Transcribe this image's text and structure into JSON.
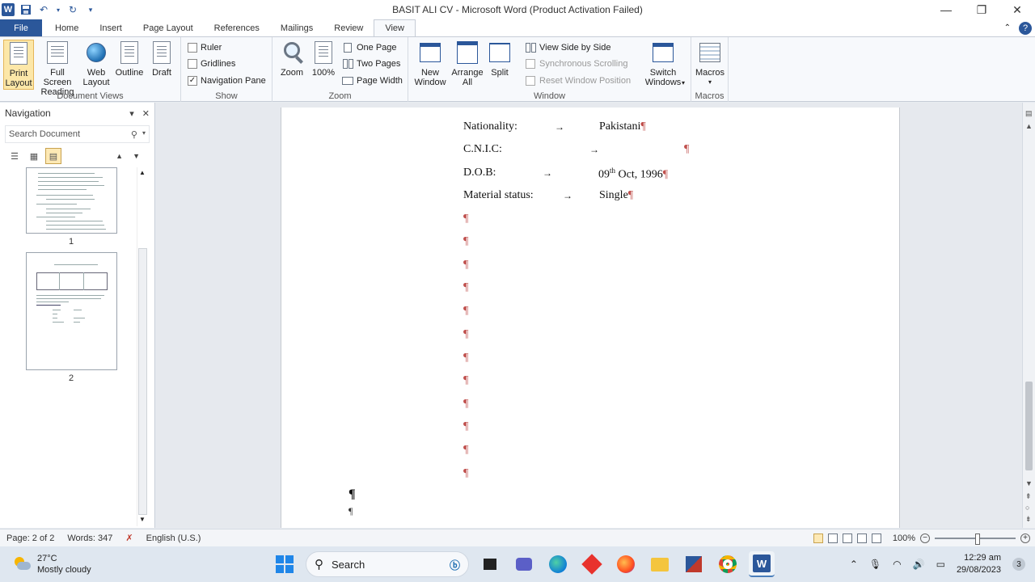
{
  "window": {
    "title": "BASIT ALI CV  -  Microsoft Word (Product Activation Failed)"
  },
  "ribbon_tabs": [
    "File",
    "Home",
    "Insert",
    "Page Layout",
    "References",
    "Mailings",
    "Review",
    "View"
  ],
  "active_tab": "View",
  "ribbon": {
    "document_views": {
      "label": "Document Views",
      "print_layout": "Print Layout",
      "full_screen_reading": "Full Screen Reading",
      "web_layout": "Web Layout",
      "outline": "Outline",
      "draft": "Draft"
    },
    "show": {
      "label": "Show",
      "ruler": "Ruler",
      "ruler_checked": false,
      "gridlines": "Gridlines",
      "gridlines_checked": false,
      "navigation_pane": "Navigation Pane",
      "navigation_pane_checked": true
    },
    "zoom": {
      "label": "Zoom",
      "zoom": "Zoom",
      "hundred": "100%",
      "one_page": "One Page",
      "two_pages": "Two Pages",
      "page_width": "Page Width"
    },
    "window_group": {
      "label": "Window",
      "new_window": "New Window",
      "arrange_all": "Arrange All",
      "split": "Split",
      "view_side_by_side": "View Side by Side",
      "synchronous_scrolling": "Synchronous Scrolling",
      "reset_window_position": "Reset Window Position",
      "switch_windows": "Switch Windows"
    },
    "macros": {
      "label": "Macros",
      "macros": "Macros"
    }
  },
  "navigation": {
    "title": "Navigation",
    "search_placeholder": "Search Document",
    "page_numbers": [
      "1",
      "2"
    ]
  },
  "document": {
    "rows": [
      {
        "label": "Nationality:",
        "value": "Pakistani"
      },
      {
        "label": "C.N.I.C:",
        "value": ""
      },
      {
        "label": "D.O.B:",
        "value_prefix": "09",
        "value_sup": "th",
        "value_suffix": "Oct, 1996"
      },
      {
        "label": "Material status:",
        "value": "Single"
      }
    ],
    "pilcrow": "¶",
    "tab_arrow": "→"
  },
  "status": {
    "page": "Page: 2 of 2",
    "words": "Words: 347",
    "language": "English (U.S.)",
    "zoom": "100%"
  },
  "taskbar": {
    "temperature": "27°C",
    "condition": "Mostly cloudy",
    "search_label": "Search",
    "time": "12:29 am",
    "date": "29/08/2023",
    "notification_count": "3"
  }
}
